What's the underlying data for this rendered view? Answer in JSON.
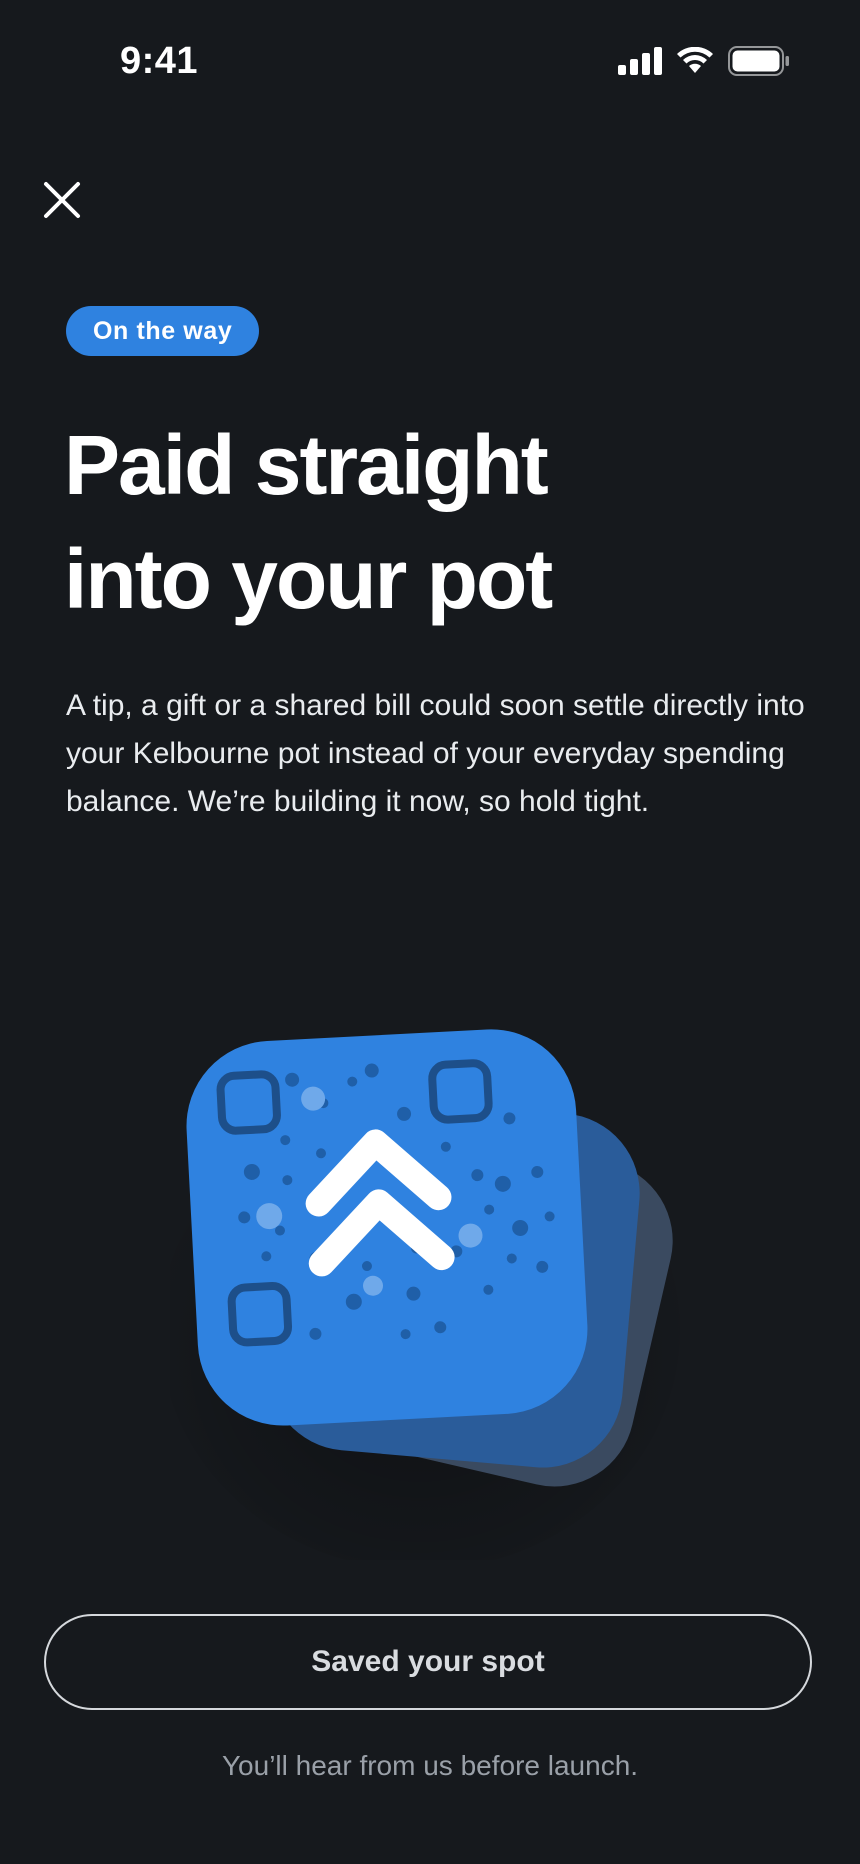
{
  "status_bar": {
    "time": "9:41",
    "icons": [
      "cellular-signal-icon",
      "wifi-icon",
      "battery-icon"
    ]
  },
  "close_button": {
    "icon": "close-icon"
  },
  "badge": {
    "label": "On the way",
    "color": "#2f82e0"
  },
  "headline": {
    "line1": "Paid straight",
    "line2": "into your pot"
  },
  "body": {
    "text": "A tip, a gift or a shared bill could soon settle directly into your Kelbourne pot instead of your everyday spending balance. We’re building it now, so hold tight."
  },
  "illustration": {
    "icon": "qr-code-upload-icon",
    "card_color": "#2f82e0",
    "back_card_color": "#2a5c9a",
    "rear_card_color": "#3a4a60"
  },
  "cta": {
    "label": "Saved your spot"
  },
  "footnote": {
    "text": "You’ll hear from us before launch."
  },
  "colors": {
    "background": "#16191d",
    "accent": "#2f82e0"
  }
}
